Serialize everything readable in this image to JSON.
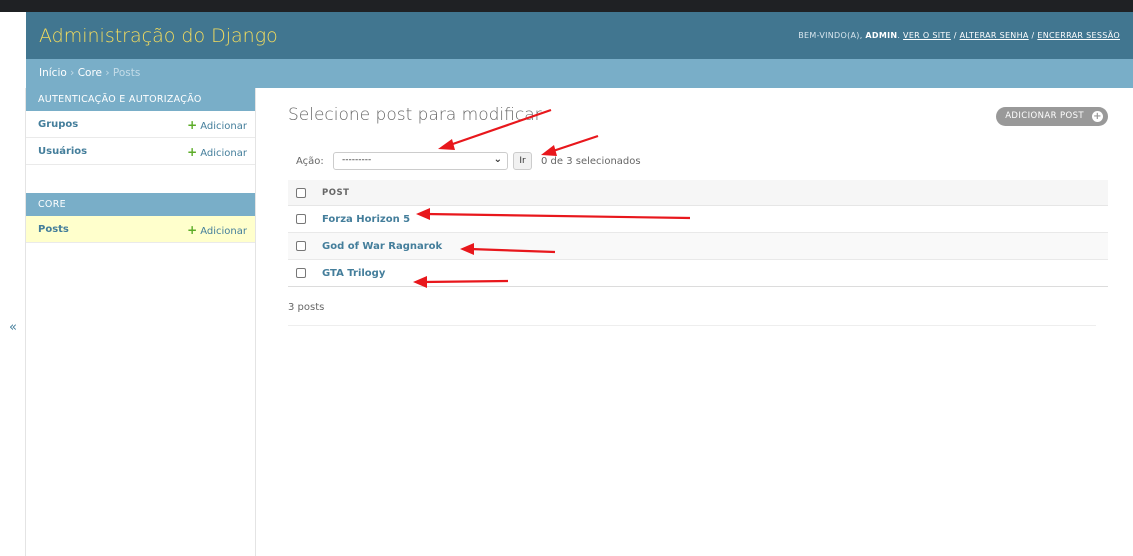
{
  "header": {
    "site_title": "Administração do Django",
    "welcome": "BEM-VINDO(A),",
    "username": "ADMIN",
    "view_site": "VER O SITE",
    "change_password": "ALTERAR SENHA",
    "logout": "ENCERRAR SESSÃO",
    "separator": "/"
  },
  "breadcrumbs": {
    "home": "Início",
    "app": "Core",
    "current": "Posts",
    "separator": "›"
  },
  "sidebar": {
    "toggle_icon": "«",
    "modules": [
      {
        "caption": "AUTENTICAÇÃO E AUTORIZAÇÃO",
        "models": [
          {
            "name": "Grupos",
            "add_label": "Adicionar"
          },
          {
            "name": "Usuários",
            "add_label": "Adicionar"
          }
        ]
      },
      {
        "caption": "CORE",
        "models": [
          {
            "name": "Posts",
            "add_label": "Adicionar",
            "current": true
          }
        ]
      }
    ]
  },
  "main": {
    "title": "Selecione post para modificar",
    "add_button": "ADICIONAR POST",
    "action_label": "Ação:",
    "action_selected": "---------",
    "go_button": "Ir",
    "selection_counter": "0 de 3 selecionados",
    "column_header": "POST",
    "rows": [
      "Forza Horizon 5",
      "God of War Ragnarok",
      "GTA Trilogy"
    ],
    "result_count": "3 posts"
  },
  "colors": {
    "header_bg": "#417690",
    "breadcrumb_bg": "#79aec8",
    "title_yellow": "#f5dd5d",
    "link_blue": "#447e9b",
    "add_green": "#5cac28",
    "annotation_red": "#e8171c",
    "selected_row_bg": "#ffffcc"
  },
  "icons": {
    "sidebar_add": "plus-icon",
    "add_button": "plus-circle-icon",
    "select": "chevron-down-icon",
    "sidebar_toggle": "double-chevron-left-icon"
  }
}
